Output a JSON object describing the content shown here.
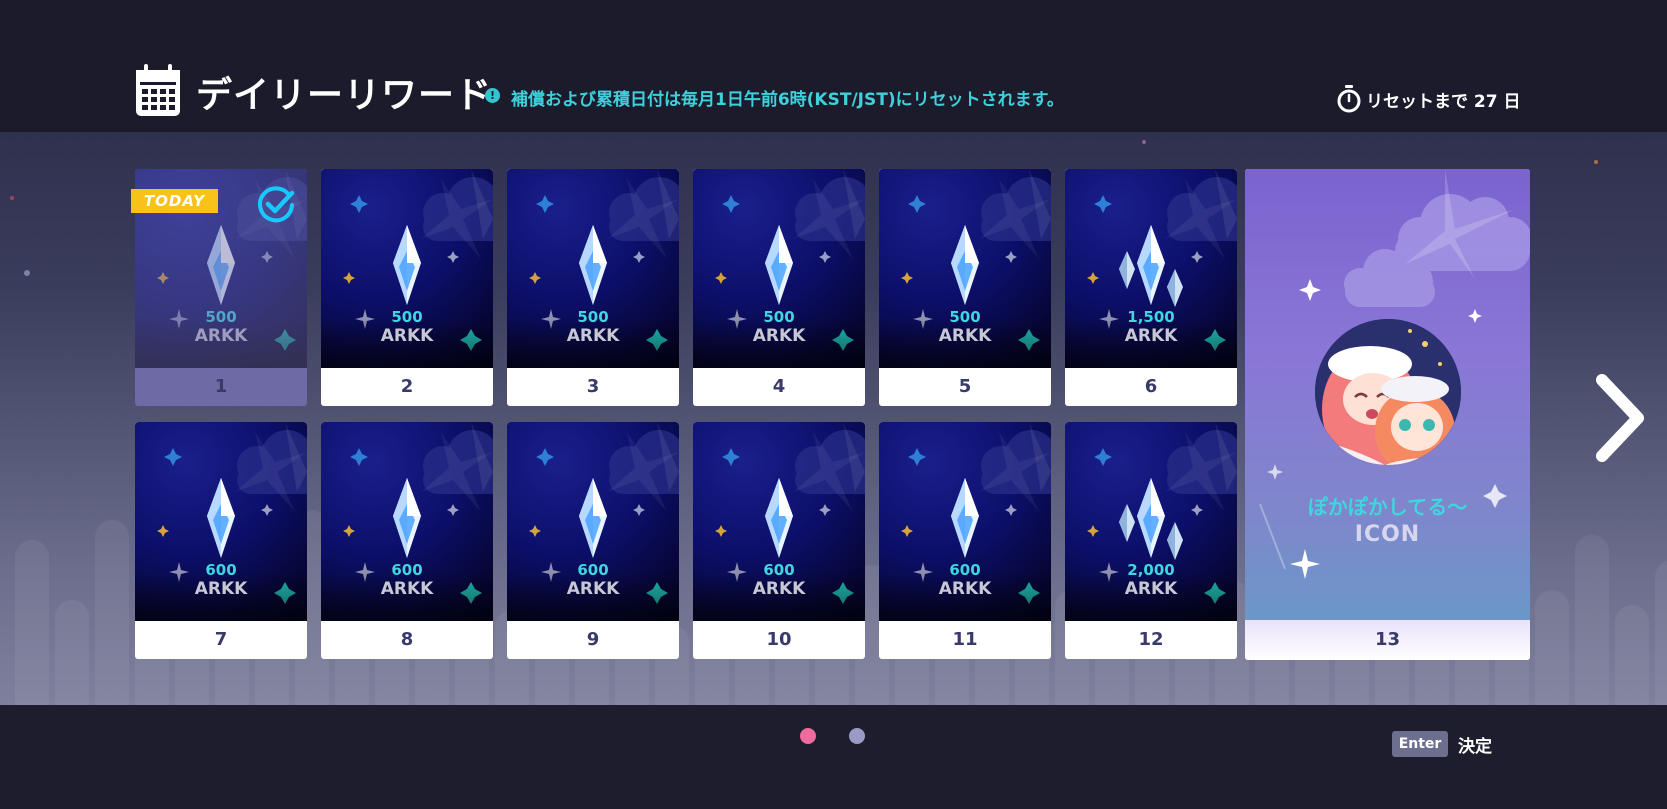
{
  "header": {
    "title": "デイリーリワード",
    "notice_icon": "!",
    "notice": "補償および累積日付は毎月1日午前6時(KST/JST)にリセットされます。",
    "reset_label": "リセットまで 27 日"
  },
  "today_badge": "TODAY",
  "cards": [
    {
      "day": "1",
      "amount": "500",
      "unit": "ARKK",
      "gems": 1,
      "state": "claimed"
    },
    {
      "day": "2",
      "amount": "500",
      "unit": "ARKK",
      "gems": 1,
      "state": "locked"
    },
    {
      "day": "3",
      "amount": "500",
      "unit": "ARKK",
      "gems": 1,
      "state": "locked"
    },
    {
      "day": "4",
      "amount": "500",
      "unit": "ARKK",
      "gems": 1,
      "state": "locked"
    },
    {
      "day": "5",
      "amount": "500",
      "unit": "ARKK",
      "gems": 1,
      "state": "locked"
    },
    {
      "day": "6",
      "amount": "1,500",
      "unit": "ARKK",
      "gems": 3,
      "state": "locked"
    },
    {
      "day": "7",
      "amount": "600",
      "unit": "ARKK",
      "gems": 1,
      "state": "locked"
    },
    {
      "day": "8",
      "amount": "600",
      "unit": "ARKK",
      "gems": 1,
      "state": "locked"
    },
    {
      "day": "9",
      "amount": "600",
      "unit": "ARKK",
      "gems": 1,
      "state": "locked"
    },
    {
      "day": "10",
      "amount": "600",
      "unit": "ARKK",
      "gems": 1,
      "state": "locked"
    },
    {
      "day": "11",
      "amount": "600",
      "unit": "ARKK",
      "gems": 1,
      "state": "locked"
    },
    {
      "day": "12",
      "amount": "2,000",
      "unit": "ARKK",
      "gems": 3,
      "state": "locked"
    }
  ],
  "special_card": {
    "day": "13",
    "name": "ぽかぽかしてる～",
    "type": "ICON"
  },
  "pagination": {
    "current": 1,
    "total": 2
  },
  "footer": {
    "key": "Enter",
    "action": "決定"
  },
  "colors": {
    "accent_cyan": "#3fd6e0",
    "today_yellow": "#f8c21a",
    "active_dot": "#f16c9c",
    "inactive_dot": "#9a9ac4"
  }
}
